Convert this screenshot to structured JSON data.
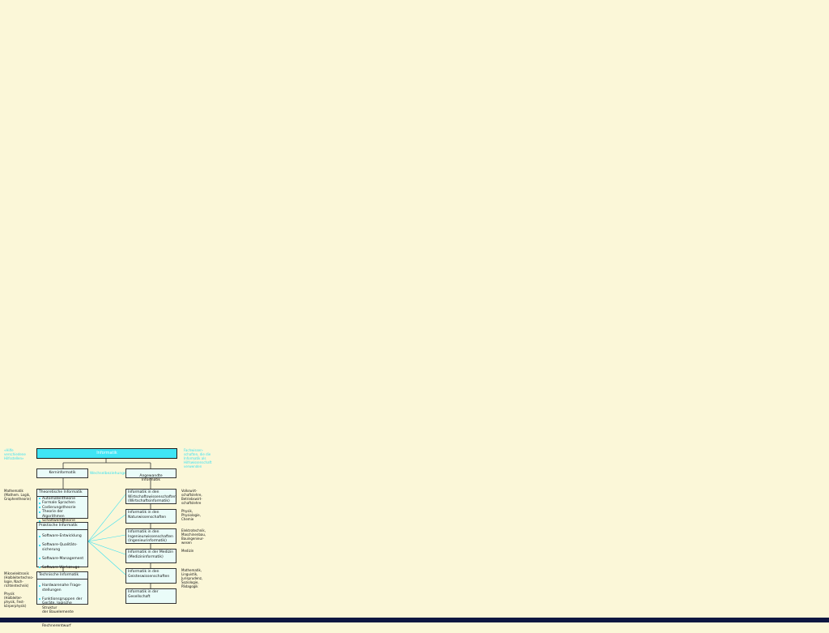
{
  "top": {
    "title": "Informatik",
    "left_note": "«Hilfe\nverschiedene\nHilfsstellen»",
    "right_note": "Fachwissen-\nschaften, die die\nInformatik als\nHilfswissenschaft\nverwenden"
  },
  "kern": {
    "label": "Kerninformatik"
  },
  "angewandt": {
    "label": "Angewandte\nInformatik"
  },
  "middle_label": "Wechselbeziehungen",
  "theoretische": {
    "title": "Theoretische Informatik",
    "items": [
      "Automatentheorie",
      "Formale Sprachen",
      "Codierungstheorie",
      "Theorie der Algorithmen",
      "Schaltwerktheorie"
    ]
  },
  "praktische": {
    "title": "Praktische Informatik",
    "items": [
      "Software-Entwicklung",
      "Software-Qualitäts-\nsicherung",
      "Software-Management",
      "Software-Werkzeuge",
      "Betriebssysteme",
      "Datenbanken",
      "Computernetze",
      "Compilerbau"
    ]
  },
  "technische": {
    "title": "Technische Informatik",
    "items": [
      "Hardwarenahe Frage-\nstellungen",
      "Funktionsgruppen der\nGeräte, logische Struktur\nder Bauelemente",
      "logischer Rechnerentwurf"
    ]
  },
  "left_notes": {
    "math": "Mathematik\n(Mathem. Logik,\nGraphentheorie)",
    "micro": "Mikroelektronik\n(Halbleitertechno-\nlogie, Nach-\nrichtentechnik)",
    "physics": "Physik\n(Halbleiter-\nphysik, Fest-\nkörperphysik)"
  },
  "applied": [
    {
      "label": "Informatik in den\nWirtschaftswissenschaften\n(Wirtschaftsinformatik)",
      "note": "Volkswirt-\nschaftslehre,\nBetriebswirt-\nschaftslehre"
    },
    {
      "label": "Informatik in den\nNaturwissenschaften",
      "note": "Physik,\nPhysiologie,\nChemie"
    },
    {
      "label": "Informatik in den\nIngenieurwissenschaften\n(Ingenieurinformatik)",
      "note": "Elektrotechnik,\nMaschinenbau,\nBauingenieur-\nwesen"
    },
    {
      "label": "Informatik in der Medizin\n(Medizininformatik)",
      "note": "Medizin"
    },
    {
      "label": "Informatik in den\nGeisteswissenschaften",
      "note": "Mathematik,\nLinguistik,\nJurisprudenz,\nSoziologie,\nPädagogik"
    },
    {
      "label": "Informatik in der\nGesellschaft",
      "note": ""
    }
  ],
  "colors": {
    "background": "#fbf7d8",
    "accent": "#3fe5f5",
    "box_fill": "#eafcf9",
    "taskbar": "#0d1640"
  }
}
